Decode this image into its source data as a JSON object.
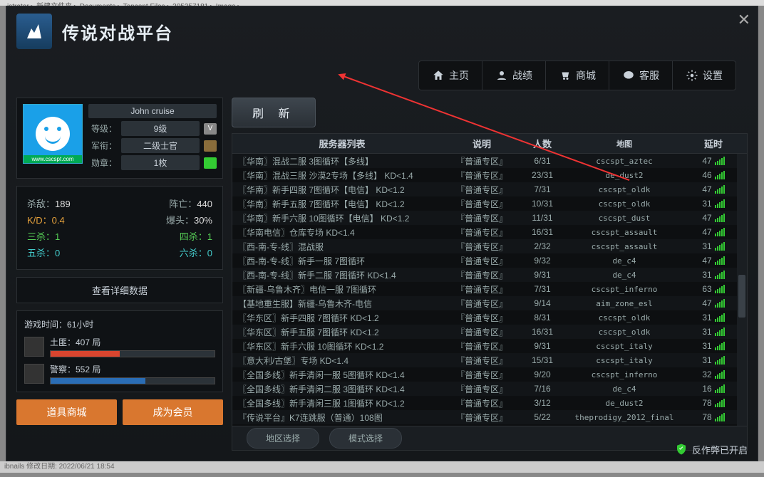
{
  "breadcrumb": "istrator ▸ 新建文件夹 ▸ Documents ▸ Tencent Files ▸ 305257181 ▸ Image ▸",
  "app_title": "传说对战平台",
  "nav": [
    {
      "label": "主页"
    },
    {
      "label": "战绩"
    },
    {
      "label": "商城"
    },
    {
      "label": "客服"
    },
    {
      "label": "设置"
    }
  ],
  "profile": {
    "username": "John cruise",
    "avatar_url": "www.cscspt.com",
    "rows": [
      {
        "label": "等级：",
        "value": "9级"
      },
      {
        "label": "军衔：",
        "value": "二级士官"
      },
      {
        "label": "勋章：",
        "value": "1枚"
      }
    ]
  },
  "stats": {
    "kill_l": "杀敌：",
    "kill_v": "189",
    "death_l": "阵亡：",
    "death_v": "440",
    "kd_l": "K/D：",
    "kd_v": "0.4",
    "hs_l": "爆头：",
    "hs_v": "30%",
    "tk_l": "三杀：",
    "tk_v": "1",
    "qk_l": "四杀：",
    "qk_v": "1",
    "fk_l": "五杀：",
    "fk_v": "0",
    "sk_l": "六杀：",
    "sk_v": "0"
  },
  "detail_btn": "查看详细数据",
  "gametime": {
    "label": "游戏时间：",
    "value": "61小时",
    "roles": [
      {
        "name": "土匪：",
        "count": "407 局",
        "pct": 42,
        "color": "red"
      },
      {
        "name": "警察：",
        "count": "552 局",
        "pct": 58,
        "color": "blue"
      }
    ]
  },
  "btns": {
    "shop": "道具商城",
    "vip": "成为会员"
  },
  "refresh": "刷 新",
  "columns": {
    "c1": "服务器列表",
    "c2": "说明",
    "c3": "人数",
    "c4": "地图",
    "c5": "延时"
  },
  "servers": [
    {
      "n": "〖华南〗混战二服 3图循环【多线】",
      "d": "『普通专区』",
      "p": "6/31",
      "m": "cscspt_aztec",
      "l": "47"
    },
    {
      "n": "〖华南〗混战三服 沙漠2专场【多线】 KD<1.4",
      "d": "『普通专区』",
      "p": "23/31",
      "m": "de_dust2",
      "l": "46"
    },
    {
      "n": "〖华南〗新手四服 7图循环【电信】 KD<1.2",
      "d": "『普通专区』",
      "p": "7/31",
      "m": "cscspt_oldk",
      "l": "47"
    },
    {
      "n": "〖华南〗新手五服 7图循环【电信】 KD<1.2",
      "d": "『普通专区』",
      "p": "10/31",
      "m": "cscspt_oldk",
      "l": "31"
    },
    {
      "n": "〖华南〗新手六服 10图循环【电信】 KD<1.2",
      "d": "『普通专区』",
      "p": "11/31",
      "m": "cscspt_dust",
      "l": "47"
    },
    {
      "n": "〖华南电信〗仓库专场 KD<1.4",
      "d": "『普通专区』",
      "p": "16/31",
      "m": "cscspt_assault",
      "l": "47"
    },
    {
      "n": "〖西-南-专-线〗混战服",
      "d": "『普通专区』",
      "p": "2/32",
      "m": "cscspt_assault",
      "l": "31"
    },
    {
      "n": "〖西-南-专-线〗新手一服 7图循环",
      "d": "『普通专区』",
      "p": "9/32",
      "m": "de_c4",
      "l": "47"
    },
    {
      "n": "〖西-南-专-线〗新手二服 7图循环 KD<1.4",
      "d": "『普通专区』",
      "p": "9/31",
      "m": "de_c4",
      "l": "31"
    },
    {
      "n": "〖新疆-乌鲁木齐〗电信一服 7图循环",
      "d": "『普通专区』",
      "p": "7/31",
      "m": "cscspt_inferno",
      "l": "63"
    },
    {
      "n": "【基地重生服】新疆-乌鲁木齐-电信",
      "d": "『普通专区』",
      "p": "9/14",
      "m": "aim_zone_esl",
      "l": "47"
    },
    {
      "n": "〖华东区〗新手四服 7图循环 KD<1.2",
      "d": "『普通专区』",
      "p": "8/31",
      "m": "cscspt_oldk",
      "l": "31"
    },
    {
      "n": "〖华东区〗新手五服 7图循环 KD<1.2",
      "d": "『普通专区』",
      "p": "16/31",
      "m": "cscspt_oldk",
      "l": "31"
    },
    {
      "n": "〖华东区〗新手六服 10图循环 KD<1.2",
      "d": "『普通专区』",
      "p": "9/31",
      "m": "cscspt_italy",
      "l": "31"
    },
    {
      "n": "〖意大利/古堡〗专场 KD<1.4",
      "d": "『普通专区』",
      "p": "15/31",
      "m": "cscspt_italy",
      "l": "31"
    },
    {
      "n": "〖全国多线〗新手清闲一服 5图循环 KD<1.4",
      "d": "『普通专区』",
      "p": "9/20",
      "m": "cscspt_inferno",
      "l": "32"
    },
    {
      "n": "〖全国多线〗新手清闲二服 3图循环 KD<1.4",
      "d": "『普通专区』",
      "p": "7/16",
      "m": "de_c4",
      "l": "16"
    },
    {
      "n": "〖全国多线〗新手清闲三服 1图循环 KD<1.2",
      "d": "『普通专区』",
      "p": "3/12",
      "m": "de_dust2",
      "l": "78"
    },
    {
      "n": "『传说平台』K7连跳服（普通）108图",
      "d": "『普通专区』",
      "p": "5/22",
      "m": "theprodigy_2012_final",
      "l": "78"
    }
  ],
  "pill": {
    "region": "地区选择",
    "mode": "模式选择"
  },
  "anticheat": "反作弊已开启",
  "footer_gray": "ibnails  修改日期: 2022/06/21 18:54"
}
